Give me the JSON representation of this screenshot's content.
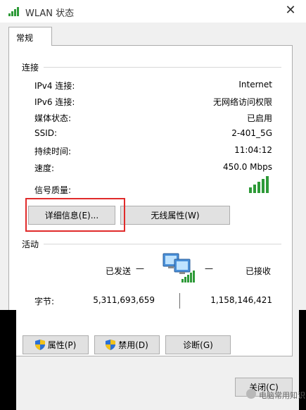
{
  "window": {
    "title": "WLAN 状态",
    "close_glyph": "✕"
  },
  "tabs": [
    {
      "label": "常规"
    }
  ],
  "connection": {
    "section_label": "连接",
    "rows": [
      {
        "label": "IPv4 连接:",
        "value": "Internet"
      },
      {
        "label": "IPv6 连接:",
        "value": "无网络访问权限"
      },
      {
        "label": "媒体状态:",
        "value": "已启用"
      },
      {
        "label": "SSID:",
        "value": "2-401_5G"
      },
      {
        "label": "持续时间:",
        "value": "11:04:12"
      },
      {
        "label": "速度:",
        "value": "450.0 Mbps"
      }
    ],
    "signal_label": "信号质量:",
    "signal_level": "5 of 5 bars",
    "details_button": "详细信息(E)...",
    "wireless_button": "无线属性(W)"
  },
  "activity": {
    "section_label": "活动",
    "sent_label": "已发送",
    "received_label": "已接收",
    "dash": "—",
    "bytes_label": "字节:",
    "bytes_sent": "5,311,693,659",
    "bytes_received": "1,158,146,421"
  },
  "buttons": {
    "properties": "属性(P)",
    "disable": "禁用(D)",
    "diagnose": "诊断(G)",
    "close": "关闭(C)"
  },
  "watermark": {
    "text": "电脑常用知识"
  },
  "colors": {
    "highlight": "#e02b2b",
    "signal_green": "#2e9a38",
    "shield_blue": "#2a6fd6",
    "shield_yellow": "#f2c21b"
  },
  "icons": [
    "wifi-signal-icon",
    "close-icon",
    "network-computers-icon",
    "signal-bars-icon",
    "shield-icon"
  ]
}
